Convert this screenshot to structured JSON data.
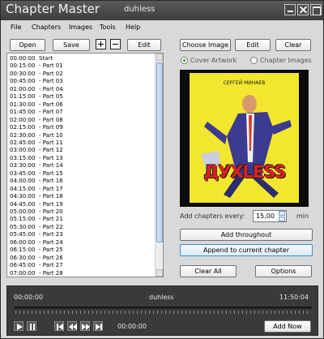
{
  "window": {
    "app_title": "Chapter Master",
    "file_title": "duhless"
  },
  "menu": [
    "File",
    "Chapters",
    "Images",
    "Tools",
    "Help"
  ],
  "toolbar": {
    "open": "Open",
    "save": "Save",
    "edit": "Edit"
  },
  "image_toolbar": {
    "choose": "Choose Image",
    "edit": "Edit",
    "clear": "Clear"
  },
  "image_source": {
    "cover": "Cover Artwork",
    "chapter": "Chapter Images",
    "selected": "Cover Artwork"
  },
  "cover_art": {
    "author": "СЕРГЕЙ МИНАЕВ",
    "logo": "ДУХLESS"
  },
  "add_every": {
    "label": "Add chapters every:",
    "value": "15,00",
    "unit": "min"
  },
  "buttons": {
    "add_throughout": "Add throughout",
    "append": "Append to current chapter",
    "clear_all": "Clear All",
    "options": "Options"
  },
  "chapters": [
    {
      "time": "00:00:00",
      "title": "Start"
    },
    {
      "time": "00:15:00",
      "title": "- Part 01"
    },
    {
      "time": "00:30:00",
      "title": "- Part 02"
    },
    {
      "time": "00:45:00",
      "title": "- Part 03"
    },
    {
      "time": "01:00:00",
      "title": "- Part 04"
    },
    {
      "time": "01:15:00",
      "title": "- Part 05"
    },
    {
      "time": "01:30:00",
      "title": "- Part 06"
    },
    {
      "time": "01:45:00",
      "title": "- Part 07"
    },
    {
      "time": "02:00:00",
      "title": "- Part 08"
    },
    {
      "time": "02:15:00",
      "title": "- Part 09"
    },
    {
      "time": "02:30:00",
      "title": "- Part 10"
    },
    {
      "time": "02:45:00",
      "title": "- Part 11"
    },
    {
      "time": "03:00:00",
      "title": "- Part 12"
    },
    {
      "time": "03:15:00",
      "title": "- Part 13"
    },
    {
      "time": "03:30:00",
      "title": "- Part 14"
    },
    {
      "time": "03:45:00",
      "title": "- Part 15"
    },
    {
      "time": "04:00:00",
      "title": "- Part 16"
    },
    {
      "time": "04:15:00",
      "title": "- Part 17"
    },
    {
      "time": "04:30:00",
      "title": "- Part 18"
    },
    {
      "time": "04:45:00",
      "title": "- Part 19"
    },
    {
      "time": "05:00:00",
      "title": "- Part 20"
    },
    {
      "time": "05:15:00",
      "title": "- Part 21"
    },
    {
      "time": "05:30:00",
      "title": "- Part 22"
    },
    {
      "time": "05:45:00",
      "title": "- Part 23"
    },
    {
      "time": "06:00:00",
      "title": "- Part 24"
    },
    {
      "time": "06:15:00",
      "title": "- Part 25"
    },
    {
      "time": "06:30:00",
      "title": "- Part 26"
    },
    {
      "time": "06:45:00",
      "title": "- Part 27"
    },
    {
      "time": "07:00:00",
      "title": "- Part 28"
    }
  ],
  "player": {
    "position": "00:00:00",
    "title": "duhless",
    "duration": "11:50:04",
    "current": "00:00:00",
    "add_now": "Add Now"
  }
}
